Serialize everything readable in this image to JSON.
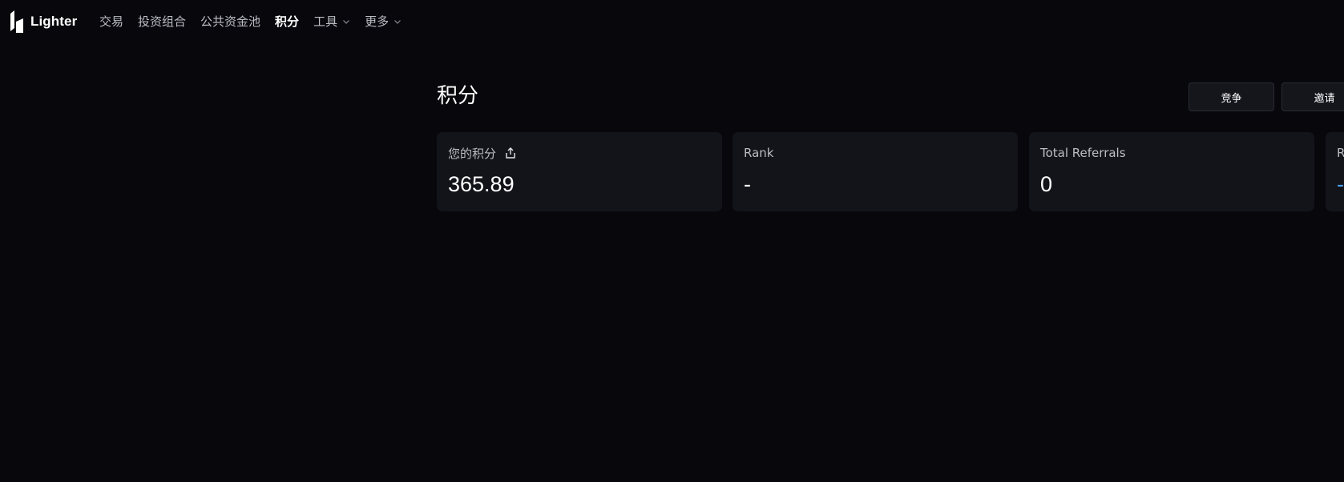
{
  "brand": {
    "name": "Lighter"
  },
  "nav": {
    "items": [
      {
        "label": "交易"
      },
      {
        "label": "投资组合"
      },
      {
        "label": "公共资金池"
      },
      {
        "label": "积分"
      },
      {
        "label": "工具"
      },
      {
        "label": "更多"
      }
    ]
  },
  "page": {
    "title": "积分"
  },
  "actions": {
    "compete_label": "竞争",
    "invite_label": "邀请"
  },
  "stats": [
    {
      "label": "您的积分",
      "value": "365.89",
      "icon": "share-icon"
    },
    {
      "label": "Rank",
      "value": "-"
    },
    {
      "label": "Total Referrals",
      "value": "0"
    },
    {
      "label": "R",
      "value": "-"
    }
  ],
  "colors": {
    "background": "#07070c",
    "card": "#13131a",
    "accent": "#4aa3ff"
  }
}
